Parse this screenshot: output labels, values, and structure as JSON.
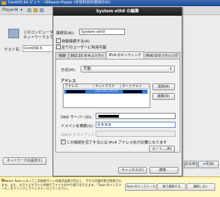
{
  "window": {
    "title": "CentOS 64 ビット - VMware Player (非営利目的使用のみ)",
    "toolbar": {
      "player_menu": "Player",
      "pause": "II",
      "dropdown": "▾"
    }
  },
  "host_panel": {
    "description_line1": "このコンピュータの",
    "description_line2": "ネットワーク上で",
    "hostname_label": "ホスト名:",
    "hostname_value": "CentOS6.6",
    "network_settings_button": "ネットワークの設定(C)",
    "back_button": "戻る(B)",
    "next_button": "次(N)"
  },
  "dialog": {
    "title": "System eth0 の編集",
    "connection_name_label": "接続名(N):",
    "connection_name_value": "System eth0",
    "auto_connect_label": "自動接続する(A)",
    "auto_connect_checked": true,
    "all_users_label": "全てのユーザーに利用可能",
    "all_users_checked": true,
    "tabs": [
      {
        "label": "有線",
        "active": false
      },
      {
        "label": "802.1X セキュリティ",
        "active": false
      },
      {
        "label": "IPv4 のセッティング",
        "active": true
      },
      {
        "label": "IPv6 のセッティング",
        "active": false
      }
    ],
    "ipv4": {
      "method_label": "方式(M):",
      "method_value": "手動",
      "address_section_label": "アドレス",
      "columns": [
        "アドレス",
        "ネットマスク",
        "ゲートウェイ"
      ],
      "address_row": {
        "address": "",
        "netmask": "255.255.255.0",
        "gateway": ""
      },
      "add_button": "追加(A)",
      "delete_button": "削除(D)",
      "dns_label": "DNS サーバー(D):",
      "dns_value": "",
      "search_domain_label": "ドメインを検索(S):",
      "search_domain_value": "8.8.8.8",
      "dhcp_client_id_label": "DHCP クライアント ID(H):",
      "require_ipv4_label": "この接続を完了するには IPv4 アドレス化が必要になります",
      "require_ipv4_checked": true,
      "routes_button": "ルート... (R)"
    },
    "cancel_button": "キャンセル(C)",
    "apply_button": "適用..."
  },
  "notice": {
    "text": "VMware Tools によってこの仮想マシンの表示品質が向上し、マウスの操作性が改善されます。また、ホストとゲストとの間でファイルのやり取りを行えます。「Tools のインストール」をクリックしてインストールしてください。",
    "install_button": "Tools のインストール",
    "remind_button": "後で通知する",
    "never_button": "通知しない"
  }
}
